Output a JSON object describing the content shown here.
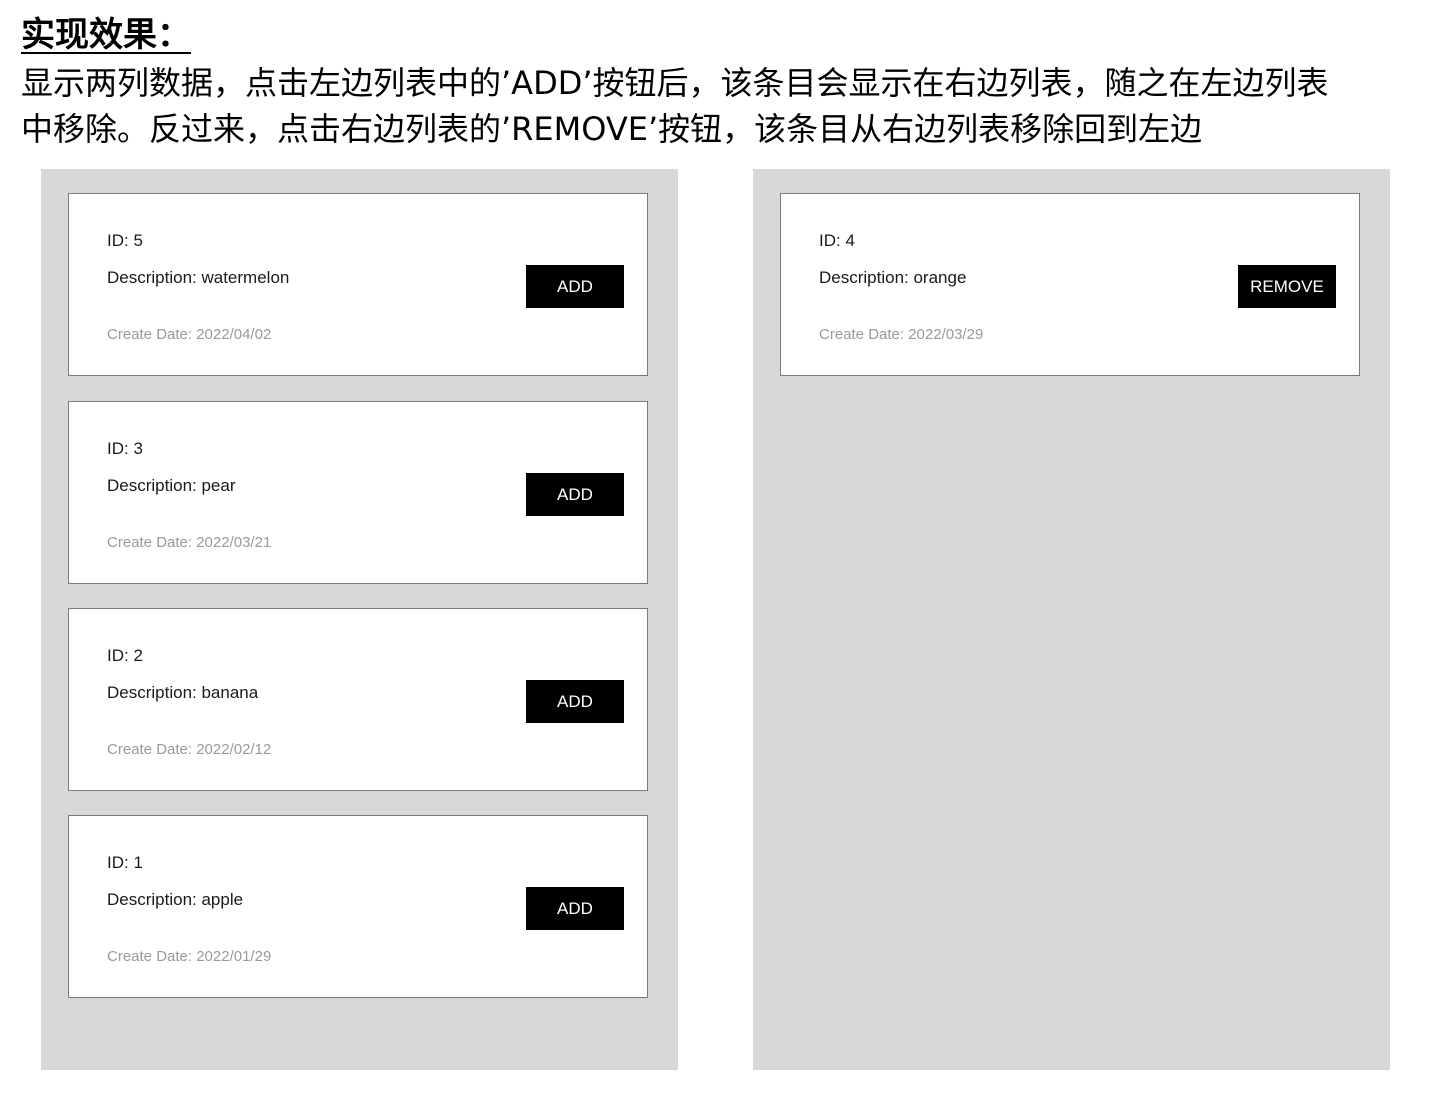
{
  "heading": "实现效果：",
  "description_lines": [
    "显示两列数据，点击左边列表中的’ADD’按钮后，该条目会显示在右边列表，随之在左边列表",
    "中移除。反过来，点击右边列表的’REMOVE’按钮，该条目从右边列表移除回到左边"
  ],
  "left_list": [
    {
      "id": "ID: 5",
      "description": "Description: watermelon",
      "date": "Create Date: 2022/04/02",
      "button": "ADD"
    },
    {
      "id": "ID: 3",
      "description": "Description: pear",
      "date": "Create Date: 2022/03/21",
      "button": "ADD"
    },
    {
      "id": "ID: 2",
      "description": "Description: banana",
      "date": "Create Date: 2022/02/12",
      "button": "ADD"
    },
    {
      "id": "ID: 1",
      "description": "Description: apple",
      "date": "Create Date: 2022/01/29",
      "button": "ADD"
    }
  ],
  "right_list": [
    {
      "id": "ID: 4",
      "description": "Description: orange",
      "date": "Create Date: 2022/03/29",
      "button": "REMOVE"
    }
  ],
  "colors": {
    "panel_bg": "#d8d8d8",
    "button_bg": "#000000",
    "date_text": "#9a9a9a"
  }
}
